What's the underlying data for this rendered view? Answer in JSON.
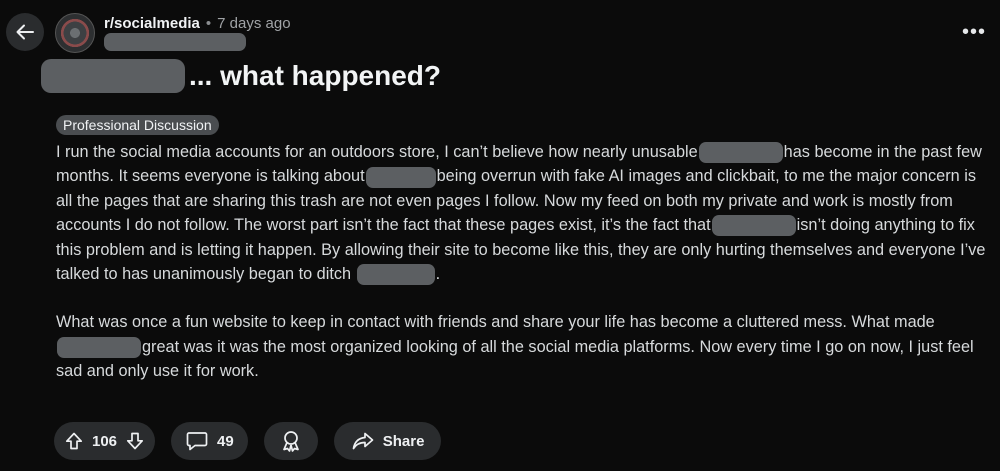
{
  "header": {
    "subreddit": "r/socialmedia",
    "separator": "•",
    "age": "7 days ago",
    "more_icon": "more-options-icon"
  },
  "post": {
    "title": "... what happened?",
    "flair": "Professional Discussion",
    "paragraph1": {
      "s1": "I run the social media accounts for an outdoors store, I can’t believe how nearly unusable",
      "s2": "has become in the past few months. It seems everyone is talking about",
      "s3": "being overrun with fake AI images and clickbait, to me the major concern is all the pages that are sharing this trash are not even pages I follow. Now my feed on both my private and work is mostly from accounts I do not follow. The worst part isn’t the fact that these pages exist, it’s the fact that",
      "s4": "isn’t doing anything to fix this problem and is letting it happen. By allowing their site to become like this, they are only hurting themselves and everyone I’ve talked to has unanimously began to ditch",
      "s5": "."
    },
    "paragraph2": {
      "s1": "What was once a fun website to keep in contact with friends and share your life has become a cluttered mess. What made",
      "s2": "great was it was the most organized looking of all the social media platforms. Now every time I go on now, I just feel sad and only use it for work."
    }
  },
  "actions": {
    "score": "106",
    "comments": "49",
    "share_label": "Share"
  },
  "colors": {
    "background": "#0b0b0b",
    "pill": "#2a2c2e",
    "flair": "#4a4d50",
    "redaction": "#5c5f62",
    "text": "#d7dadc"
  }
}
